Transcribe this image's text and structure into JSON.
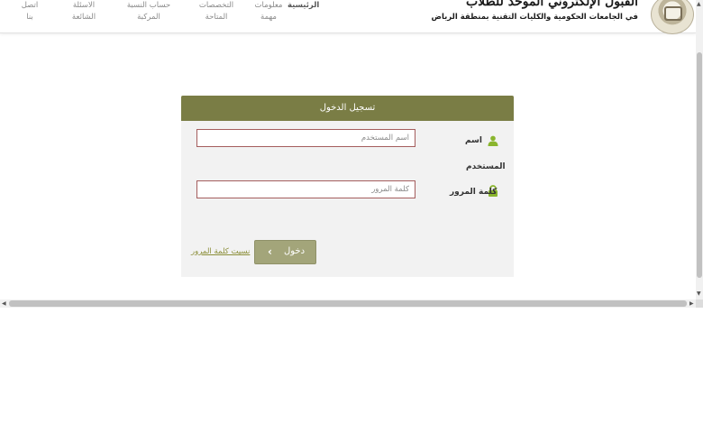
{
  "header": {
    "brand_title": "القبول الإلكتروني الموحد للطلاب",
    "brand_subtitle": "في الجامعات الحكومية والكليات التقنية بمنطقة الرياض",
    "nav": [
      {
        "label": "الرئيسية"
      },
      {
        "label": "معلومات مهمة"
      },
      {
        "label": "التخصصات المتاحة"
      },
      {
        "label": "حساب النسبة المركبة"
      },
      {
        "label": "الاسئلة الشائعة"
      },
      {
        "label": "اتصل بنا"
      }
    ]
  },
  "login": {
    "title": "تسجيل الدخول",
    "username_label": "اسم",
    "username_label_cont": "المستخدم",
    "username_placeholder": "اسم المستخدم",
    "password_label": "كلمة المرور",
    "password_placeholder": "كلمة المرور",
    "submit_label": "دخول",
    "submit_icon": "chevron-right-icon",
    "forgot_label": "نسيت كلمة المرور"
  },
  "colors": {
    "header_bar": "#7a7d45",
    "button": "#a3a57a",
    "input_border": "#a45d5d",
    "link": "#8c8f3a",
    "icon": "#8ab52e"
  }
}
